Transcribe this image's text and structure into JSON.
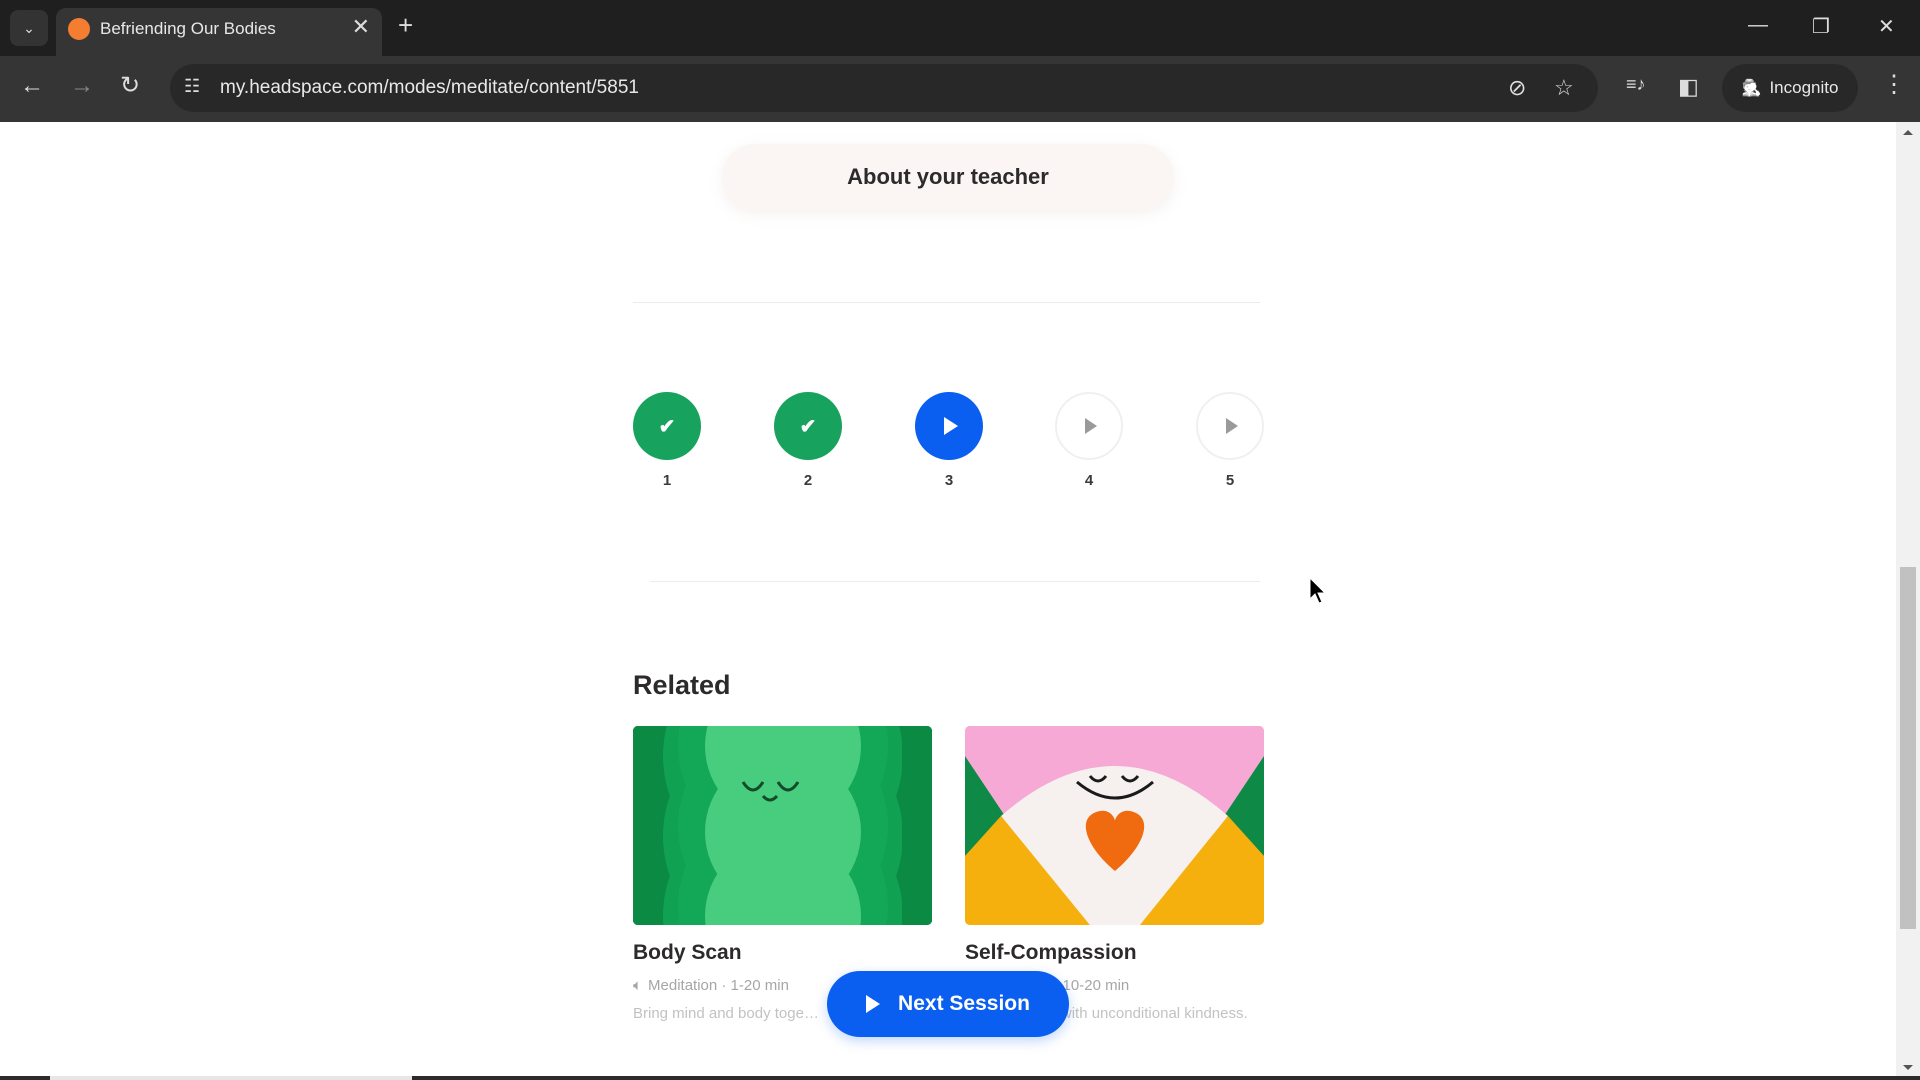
{
  "browser": {
    "tab_title": "Befriending Our Bodies",
    "favicon_color": "#f47d31",
    "url": "my.headspace.com/modes/meditate/content/5851",
    "incognito_label": "Incognito",
    "icons": {
      "tab_search": "chevron-down-icon",
      "close_tab": "close-icon",
      "new_tab": "plus-icon",
      "back": "arrow-left-icon",
      "forward": "arrow-right-icon",
      "reload": "reload-icon",
      "site_info": "tune-icon",
      "eye_off": "eye-off-icon",
      "bookmark": "star-icon",
      "media": "media-queue-icon",
      "side_panel": "side-panel-icon",
      "incognito": "incognito-icon",
      "menu": "kebab-menu-icon"
    },
    "glyphs": {
      "tab_search": "⌄",
      "close_tab": "✕",
      "new_tab": "+",
      "minimize": "—",
      "restore": "❐",
      "close_window": "✕",
      "back": "←",
      "forward": "→",
      "reload": "↻",
      "site_info": "☷",
      "eye_off": "⊘",
      "bookmark": "☆",
      "media": "≡♪",
      "side_panel": "◧",
      "incognito": "🕵",
      "menu": "⋮"
    }
  },
  "page": {
    "about_teacher_button": "About your teacher",
    "sessions": [
      {
        "number": "1",
        "status": "completed"
      },
      {
        "number": "2",
        "status": "completed"
      },
      {
        "number": "3",
        "status": "current"
      },
      {
        "number": "4",
        "status": "locked"
      },
      {
        "number": "5",
        "status": "locked"
      }
    ],
    "check_glyph": "✔",
    "related": {
      "title": "Related",
      "cards": [
        {
          "title": "Body Scan",
          "meta": "Meditation · 1-20 min",
          "meta_icon": "speaker-icon",
          "description": "Bring mind and body toge…"
        },
        {
          "title": "Self-Compassion",
          "meta": "Meditation · 10-20 min",
          "meta_icon": "speaker-icon",
          "description": "…ing yourself with unconditional kindness."
        }
      ]
    },
    "next_session_button": "Next Session",
    "colors": {
      "completed": "#17a35d",
      "current": "#0a5ff0",
      "primary_button": "#0a5ff0"
    }
  }
}
